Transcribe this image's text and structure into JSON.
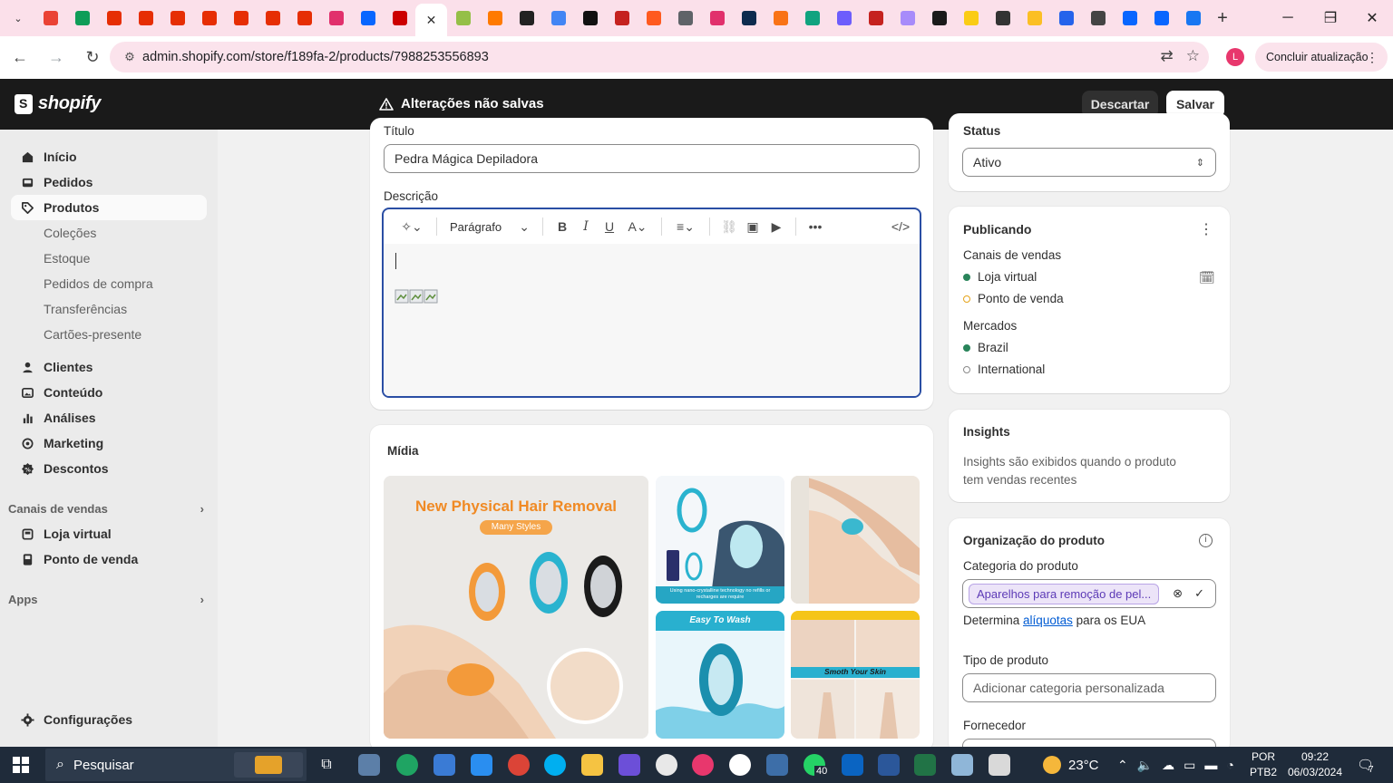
{
  "browser": {
    "favicons": [
      {
        "name": "gmail-favicon",
        "color": "#ea4335"
      },
      {
        "name": "sheets-favicon",
        "color": "#0f9d58"
      },
      {
        "name": "aliexpress-favicon-1",
        "color": "#e62e04"
      },
      {
        "name": "aliexpress-favicon-2",
        "color": "#e62e04"
      },
      {
        "name": "aliexpress-favicon-3",
        "color": "#e62e04"
      },
      {
        "name": "aliexpress-favicon-4",
        "color": "#e62e04"
      },
      {
        "name": "aliexpress-favicon-5",
        "color": "#e62e04"
      },
      {
        "name": "aliexpress-favicon-6",
        "color": "#e62e04"
      },
      {
        "name": "aliexpress-favicon-7",
        "color": "#e62e04"
      },
      {
        "name": "instagram-favicon",
        "color": "#e1306c"
      },
      {
        "name": "meta-favicon",
        "color": "#0866ff"
      },
      {
        "name": "target-favicon",
        "color": "#cc0000"
      }
    ],
    "favicons_after": [
      {
        "name": "shopify-favicon",
        "color": "#95bf47"
      },
      {
        "name": "dsers-favicon",
        "color": "#ff7a00"
      },
      {
        "name": "v-favicon",
        "color": "#222222"
      },
      {
        "name": "google-favicon",
        "color": "#4285f4"
      },
      {
        "name": "s-favicon",
        "color": "#111111"
      },
      {
        "name": "gmail-favicon-2",
        "color": "#c5221f"
      },
      {
        "name": "fire-favicon",
        "color": "#ff5a1f"
      },
      {
        "name": "globe-favicon",
        "color": "#5f6368"
      },
      {
        "name": "instagram-favicon-2",
        "color": "#e1306c"
      },
      {
        "name": "dark-favicon",
        "color": "#0d2b4e"
      },
      {
        "name": "orange-favicon",
        "color": "#f97316"
      },
      {
        "name": "chatgpt-favicon",
        "color": "#10a37f"
      },
      {
        "name": "colorful-favicon",
        "color": "#6d5dfc"
      },
      {
        "name": "gmail-favicon-3",
        "color": "#c5221f"
      },
      {
        "name": "purple-favicon",
        "color": "#a78bfa"
      },
      {
        "name": "black-favicon",
        "color": "#1a1a1a"
      },
      {
        "name": "yellow-favicon",
        "color": "#facc15"
      },
      {
        "name": "uv-favicon",
        "color": "#333333"
      },
      {
        "name": "p-favicon",
        "color": "#fbbf24"
      },
      {
        "name": "colorful-favicon-2",
        "color": "#2563eb"
      },
      {
        "name": "jk-favicon",
        "color": "#444444"
      },
      {
        "name": "meta-favicon-2",
        "color": "#0866ff"
      },
      {
        "name": "meta-favicon-3",
        "color": "#0866ff"
      },
      {
        "name": "facebook-favicon",
        "color": "#1877f2"
      }
    ],
    "url": "admin.shopify.com/store/f189fa-2/products/7988253556893",
    "update_label": "Concluir atualização",
    "profile_letter": "L"
  },
  "topbar": {
    "logo_text": "shopify",
    "unsaved": "Alterações não salvas",
    "discard": "Descartar",
    "save": "Salvar"
  },
  "sidebar": {
    "items": [
      {
        "label": "Início",
        "icon": "home-icon"
      },
      {
        "label": "Pedidos",
        "icon": "inbox-icon"
      },
      {
        "label": "Produtos",
        "icon": "tag-icon"
      }
    ],
    "product_sub": [
      "Coleções",
      "Estoque",
      "Pedidos de compra",
      "Transferências",
      "Cartões-presente"
    ],
    "items2": [
      {
        "label": "Clientes",
        "icon": "person-icon"
      },
      {
        "label": "Conteúdo",
        "icon": "image-icon"
      },
      {
        "label": "Análises",
        "icon": "bar-chart-icon"
      },
      {
        "label": "Marketing",
        "icon": "target-icon"
      },
      {
        "label": "Descontos",
        "icon": "discount-icon"
      }
    ],
    "sales_channels": "Canais de vendas",
    "channels": [
      {
        "label": "Loja virtual",
        "icon": "store-icon"
      },
      {
        "label": "Ponto de venda",
        "icon": "pos-icon"
      }
    ],
    "apps": "Apps",
    "settings": "Configurações"
  },
  "main": {
    "title_label": "Título",
    "title_value": "Pedra Mágica Depiladora",
    "description_label": "Descrição",
    "toolbar": {
      "paragraph": "Parágrafo"
    },
    "media_title": "Mídia",
    "media_main_text": "New Physical Hair Removal",
    "media_main_badge": "Many Styles",
    "media_tiles": [
      {
        "caption": "Using nano-crystalline technology no refills or recharges are require"
      },
      {
        "caption": ""
      },
      {
        "caption": "Easy To Wash"
      },
      {
        "caption": "Smoth Your Skin"
      }
    ]
  },
  "status": {
    "label": "Status",
    "value": "Ativo"
  },
  "publishing": {
    "title": "Publicando",
    "channels_label": "Canais de vendas",
    "channels": [
      {
        "label": "Loja virtual",
        "color": "#29845a"
      },
      {
        "label": "Ponto de venda",
        "color": "#e5a41b"
      }
    ],
    "markets_label": "Mercados",
    "markets": [
      {
        "label": "Brazil",
        "color": "#29845a"
      },
      {
        "label": "International",
        "color": "#8a8a8a"
      }
    ]
  },
  "insights": {
    "title": "Insights",
    "text": "Insights são exibidos quando o produto tem vendas recentes"
  },
  "organization": {
    "title": "Organização do produto",
    "category_label": "Categoria do produto",
    "category_value": "Aparelhos para remoção de pel...",
    "determina": "Determina",
    "aliquotas": "alíquotas",
    "eua": "para os EUA",
    "type_label": "Tipo de produto",
    "type_placeholder": "Adicionar categoria personalizada",
    "vendor_label": "Fornecedor"
  },
  "taskbar": {
    "search": "Pesquisar",
    "whatsapp_badge": "40",
    "weather": "23°C",
    "lang1": "POR",
    "lang2": "PTB2",
    "time": "09:22",
    "date": "06/03/2024",
    "notif": "7"
  }
}
